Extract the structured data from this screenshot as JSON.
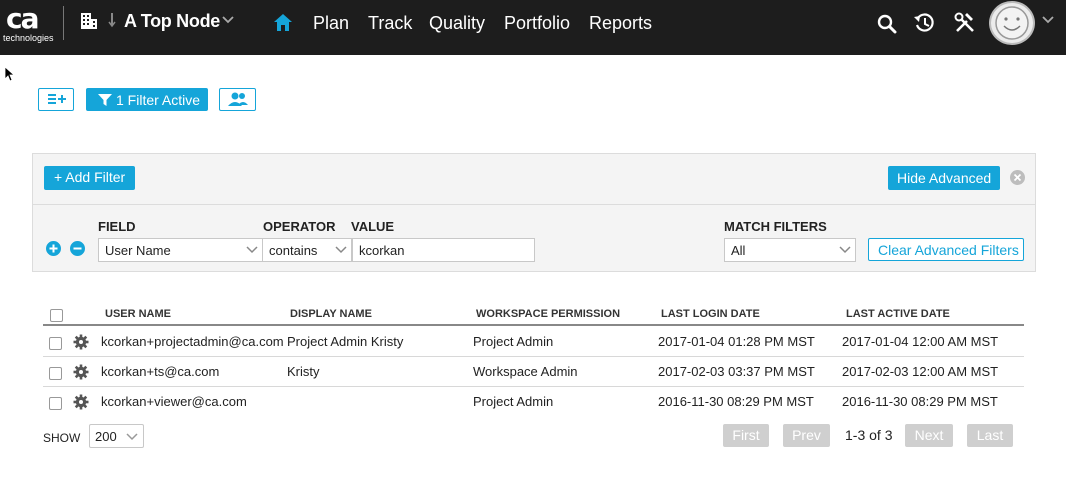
{
  "header": {
    "logo_text": "ca",
    "logo_subtext": "technologies",
    "node_name": "A Top Node",
    "nav_items": [
      {
        "label": "Plan"
      },
      {
        "label": "Track"
      },
      {
        "label": "Quality"
      },
      {
        "label": "Portfolio"
      },
      {
        "label": "Reports"
      }
    ],
    "icons": [
      "building-icon",
      "down-arrow-icon",
      "home-icon",
      "search-icon",
      "history-icon",
      "tools-icon",
      "avatar"
    ]
  },
  "toolbar": {
    "filter_label": "1 Filter Active"
  },
  "filter_panel": {
    "add_filter_label": "+ Add Filter",
    "hide_advanced_label": "Hide Advanced",
    "field_header": "FIELD",
    "operator_header": "OPERATOR",
    "value_header": "VALUE",
    "match_header": "MATCH FILTERS",
    "field_value": "User Name",
    "operator_value": "contains",
    "value_value": "kcorkan",
    "match_value": "All",
    "clear_label": "Clear Advanced Filters"
  },
  "table": {
    "headers": [
      "USER NAME",
      "DISPLAY NAME",
      "WORKSPACE PERMISSION",
      "LAST LOGIN DATE",
      "LAST ACTIVE DATE"
    ],
    "rows": [
      {
        "user_name": "kcorkan+projectadmin@ca.com",
        "display_name": "Project Admin Kristy",
        "permission": "Project Admin",
        "last_login": "2017-01-04 01:28 PM MST",
        "last_active": "2017-01-04 12:00 AM MST"
      },
      {
        "user_name": "kcorkan+ts@ca.com",
        "display_name": "Kristy",
        "permission": "Workspace Admin",
        "last_login": "2017-02-03 03:37 PM MST",
        "last_active": "2017-02-03 12:00 AM MST"
      },
      {
        "user_name": "kcorkan+viewer@ca.com",
        "display_name": "",
        "permission": "Project Admin",
        "last_login": "2016-11-30 08:29 PM MST",
        "last_active": "2016-11-30 08:29 PM MST"
      }
    ]
  },
  "footer": {
    "show_label": "SHOW",
    "page_size": "200",
    "first_label": "First",
    "prev_label": "Prev",
    "page_info": "1-3 of 3",
    "next_label": "Next",
    "last_label": "Last"
  },
  "colors": {
    "accent": "#15a5d9",
    "topbar": "#1d1d1d",
    "disabled_button": "#cfcfcf"
  }
}
